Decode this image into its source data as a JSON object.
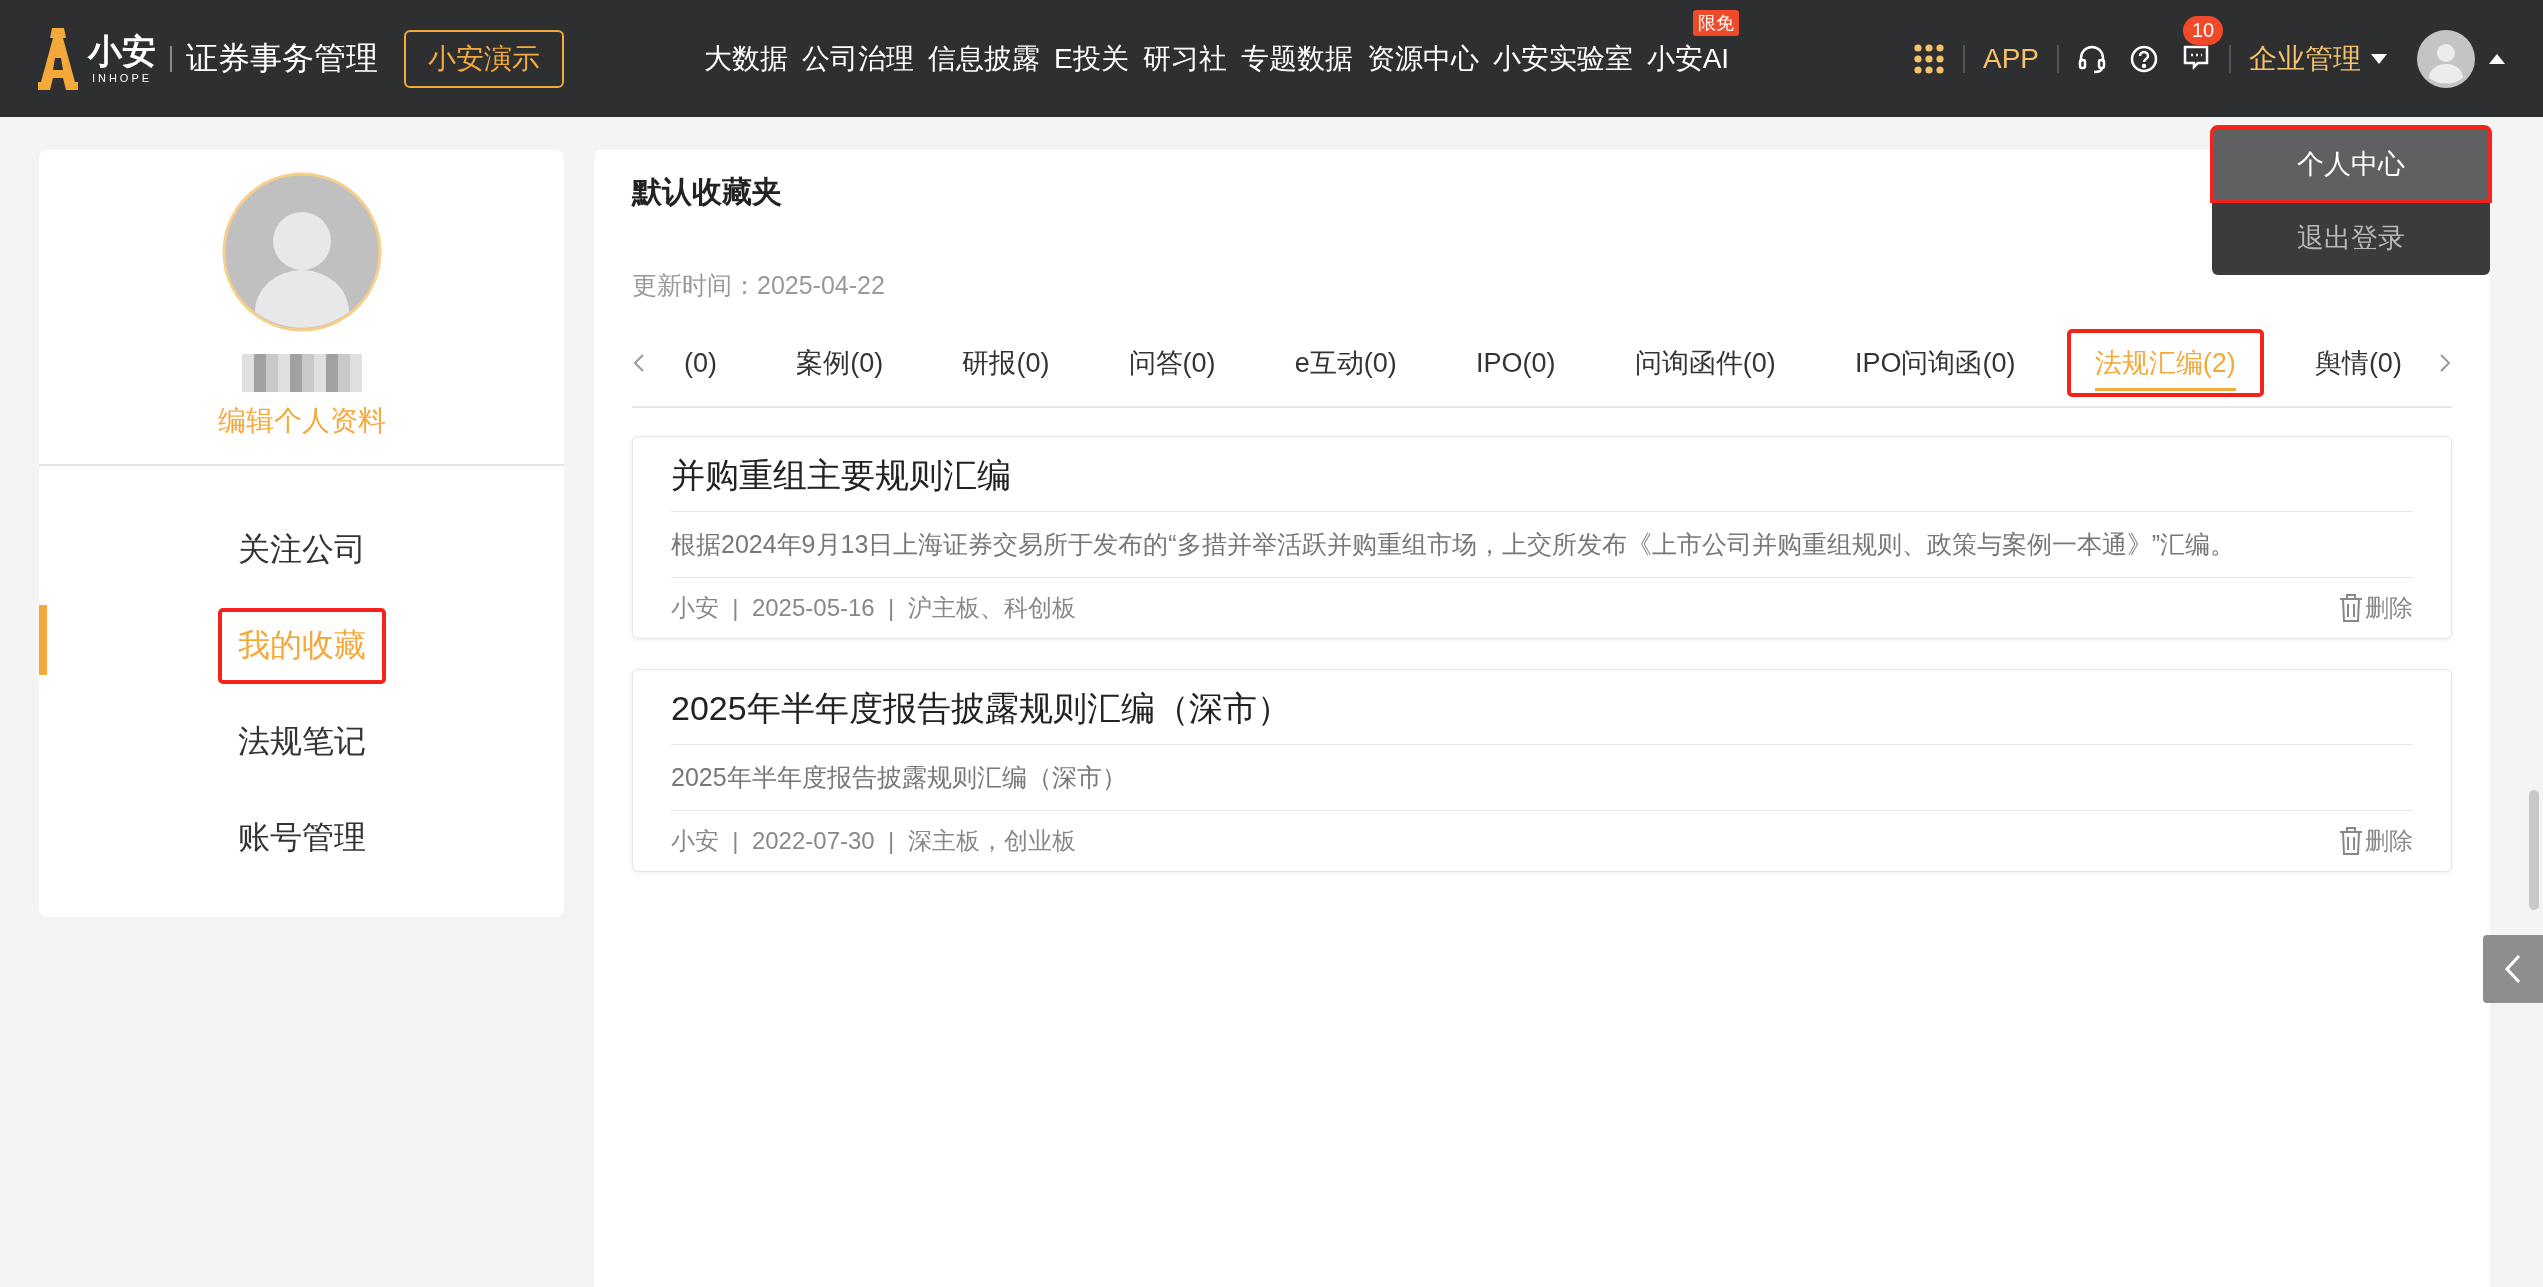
{
  "header": {
    "logo_text": "小安",
    "logo_sub": "INHOPE",
    "product": "证券事务管理",
    "demo_button": "小安演示",
    "nav": [
      {
        "label": "大数据"
      },
      {
        "label": "公司治理"
      },
      {
        "label": "信息披露"
      },
      {
        "label": "E投关"
      },
      {
        "label": "研习社"
      },
      {
        "label": "专题数据"
      },
      {
        "label": "资源中心"
      },
      {
        "label": "小安实验室"
      },
      {
        "label": "小安AI",
        "badge": "限免"
      }
    ],
    "app_link": "APP",
    "message_count": "10",
    "enterprise_menu": "企业管理",
    "user_menu": [
      {
        "label": "个人中心",
        "selected": true,
        "highlighted": true
      },
      {
        "label": "退出登录",
        "selected": false,
        "highlighted": false
      }
    ]
  },
  "sidebar": {
    "edit_profile": "编辑个人资料",
    "items": [
      {
        "label": "关注公司",
        "selected": false,
        "highlighted": false
      },
      {
        "label": "我的收藏",
        "selected": true,
        "highlighted": true
      },
      {
        "label": "法规笔记",
        "selected": false,
        "highlighted": false
      },
      {
        "label": "账号管理",
        "selected": false,
        "highlighted": false
      }
    ]
  },
  "main": {
    "title": "默认收藏夹",
    "updated": "更新时间：2025-04-22",
    "tabs": [
      {
        "label": "(0)",
        "selected": false,
        "highlighted": false
      },
      {
        "label": "案例(0)",
        "selected": false,
        "highlighted": false
      },
      {
        "label": "研报(0)",
        "selected": false,
        "highlighted": false
      },
      {
        "label": "问答(0)",
        "selected": false,
        "highlighted": false
      },
      {
        "label": "e互动(0)",
        "selected": false,
        "highlighted": false
      },
      {
        "label": "IPO(0)",
        "selected": false,
        "highlighted": false
      },
      {
        "label": "问询函件(0)",
        "selected": false,
        "highlighted": false
      },
      {
        "label": "IPO问询函(0)",
        "selected": false,
        "highlighted": false
      },
      {
        "label": "法规汇编(2)",
        "selected": true,
        "highlighted": true
      },
      {
        "label": "舆情(0)",
        "selected": false,
        "highlighted": false
      }
    ],
    "cards": [
      {
        "title": "并购重组主要规则汇编",
        "description": "根据2024年9月13日上海证券交易所于发布的“多措并举活跃并购重组市场，上交所发布《上市公司并购重组规则、政策与案例一本通》”汇编。",
        "meta": "小安  |  2025-05-16  |  沪主板、科创板",
        "delete_label": "删除"
      },
      {
        "title": "2025年半年度报告披露规则汇编（深市）",
        "description": "2025年半年度报告披露规则汇编（深市）",
        "meta": "小安  |  2022-07-30  |  深主板，创业板",
        "delete_label": "删除"
      }
    ]
  }
}
